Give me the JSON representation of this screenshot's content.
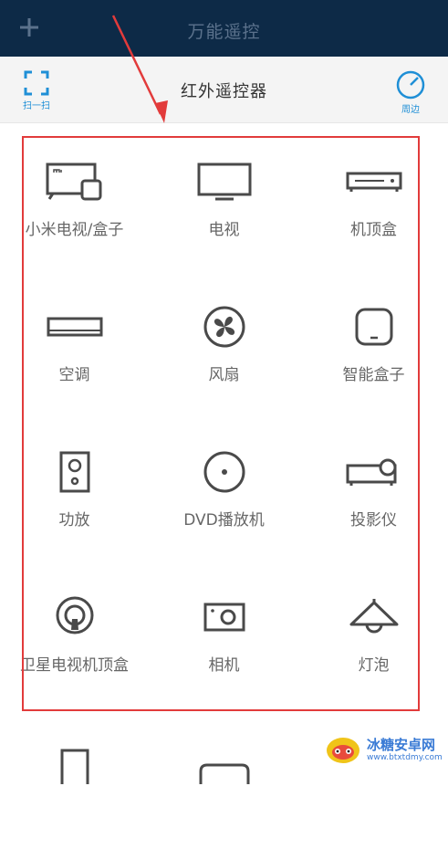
{
  "topbar": {
    "title": "万能遥控"
  },
  "subbar": {
    "scan_label": "扫一扫",
    "page_title": "红外遥控器",
    "nearby_label": "周边"
  },
  "devices": [
    {
      "label": "小米电视/盒子",
      "icon": "mi-tv-box-icon"
    },
    {
      "label": "电视",
      "icon": "tv-icon"
    },
    {
      "label": "机顶盒",
      "icon": "set-top-box-icon"
    },
    {
      "label": "空调",
      "icon": "air-conditioner-icon"
    },
    {
      "label": "风扇",
      "icon": "fan-icon"
    },
    {
      "label": "智能盒子",
      "icon": "smart-box-icon"
    },
    {
      "label": "功放",
      "icon": "amplifier-icon"
    },
    {
      "label": "DVD播放机",
      "icon": "dvd-icon"
    },
    {
      "label": "投影仪",
      "icon": "projector-icon"
    },
    {
      "label": "卫星电视机顶盒",
      "icon": "satellite-icon"
    },
    {
      "label": "相机",
      "icon": "camera-icon"
    },
    {
      "label": "灯泡",
      "icon": "lamp-icon"
    }
  ],
  "colors": {
    "topbar_bg": "#0d2a47",
    "accent": "#1f8fd6",
    "annotation": "#e23b3b"
  },
  "watermark": {
    "name": "冰糖安卓网",
    "url": "www.btxtdmy.com",
    "icon": "watermark-logo-icon"
  }
}
